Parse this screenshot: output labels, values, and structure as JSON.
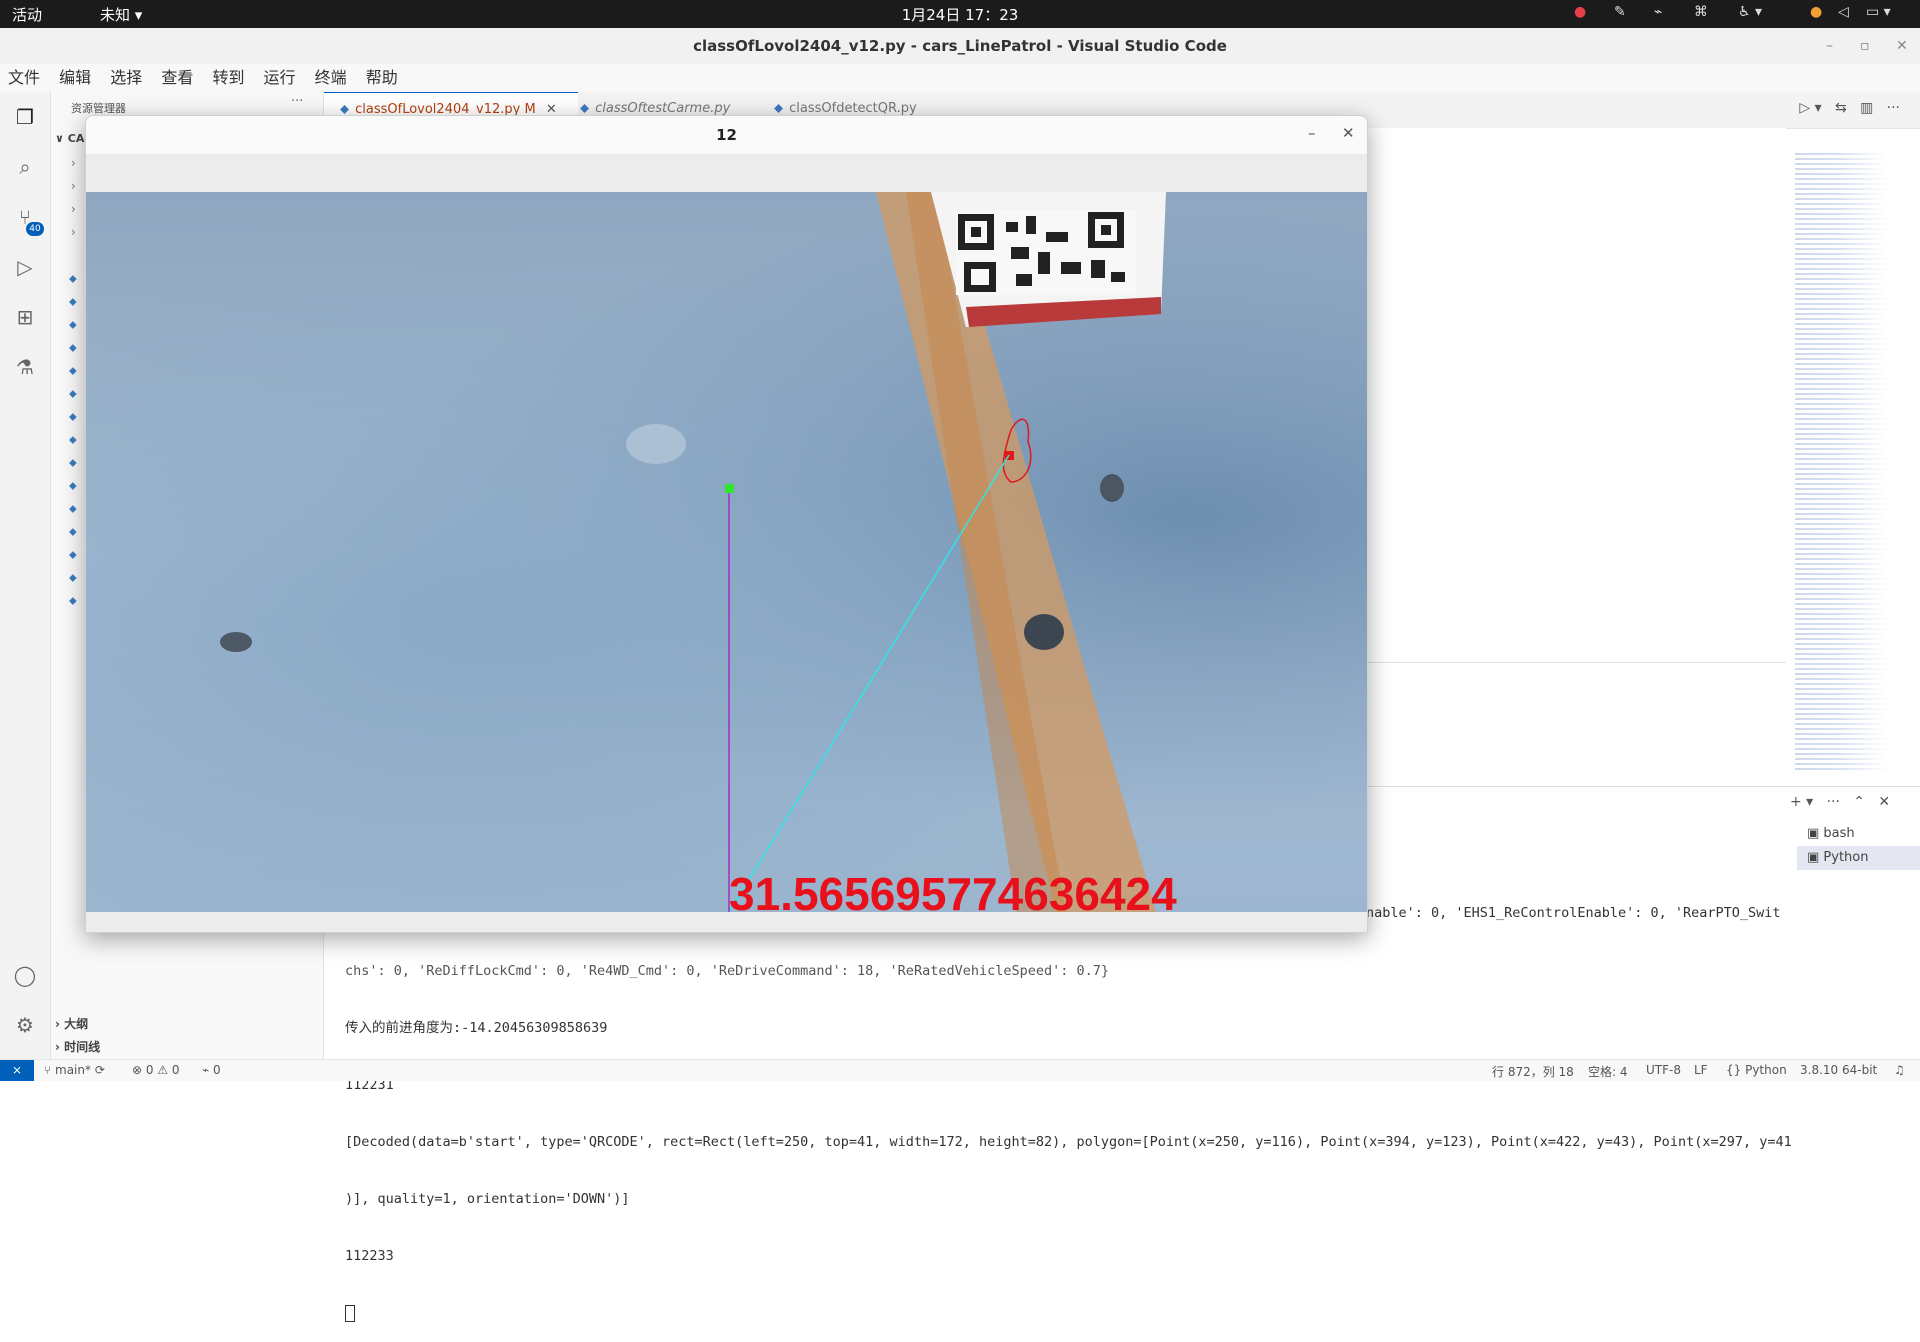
{
  "topbar": {
    "activities": "活动",
    "unknown": "未知 ▾",
    "clock": "1月24日  17：23"
  },
  "window": {
    "title": "classOfLovol2404_v12.py - cars_LinePatrol - Visual Studio Code"
  },
  "menu": [
    "文件",
    "编辑",
    "选择",
    "查看",
    "转到",
    "运行",
    "终端",
    "帮助"
  ],
  "activity": {
    "scm_badge": "40"
  },
  "sidebar": {
    "title": "资源管理器",
    "folder": "CA",
    "outline": "大纲",
    "timeline": "时间线"
  },
  "tabs": [
    {
      "label": "classOfLovol2404_v12.py",
      "modified": "M"
    },
    {
      "label": "classOftestCarme.py"
    },
    {
      "label": "classOfdetectQR.py"
    }
  ],
  "cv_window": {
    "title": "12",
    "overlay_value": "31.565695774636424"
  },
  "terminal": {
    "panel_items": [
      "bash",
      "Python"
    ],
    "right_fragment": "nable': 0, 'EHS1_ReControlEnable': 0, 'RearPTO_Swit",
    "lines": [
      "chs': 0, 'ReDiffLockCmd': 0, 'Re4WD_Cmd': 0, 'ReDriveCommand': 18, 'ReRatedVehicleSpeed': 0.7}",
      "传入的前进角度为:-14.20456309858639",
      "112231",
      "[Decoded(data=b'start', type='QRCODE', rect=Rect(left=250, top=41, width=172, height=82), polygon=[Point(x=250, y=116), Point(x=394, y=123), Point(x=422, y=43), Point(x=297, y=41",
      ")], quality=1, orientation='DOWN')]",
      "112233"
    ]
  },
  "status": {
    "branch": "main*",
    "errors": "0",
    "warnings": "0",
    "ports": "0",
    "position": "行 872，列 18",
    "spaces": "空格: 4",
    "encoding": "UTF-8",
    "eol": "LF",
    "language": "Python",
    "interpreter": "3.8.10 64-bit"
  }
}
